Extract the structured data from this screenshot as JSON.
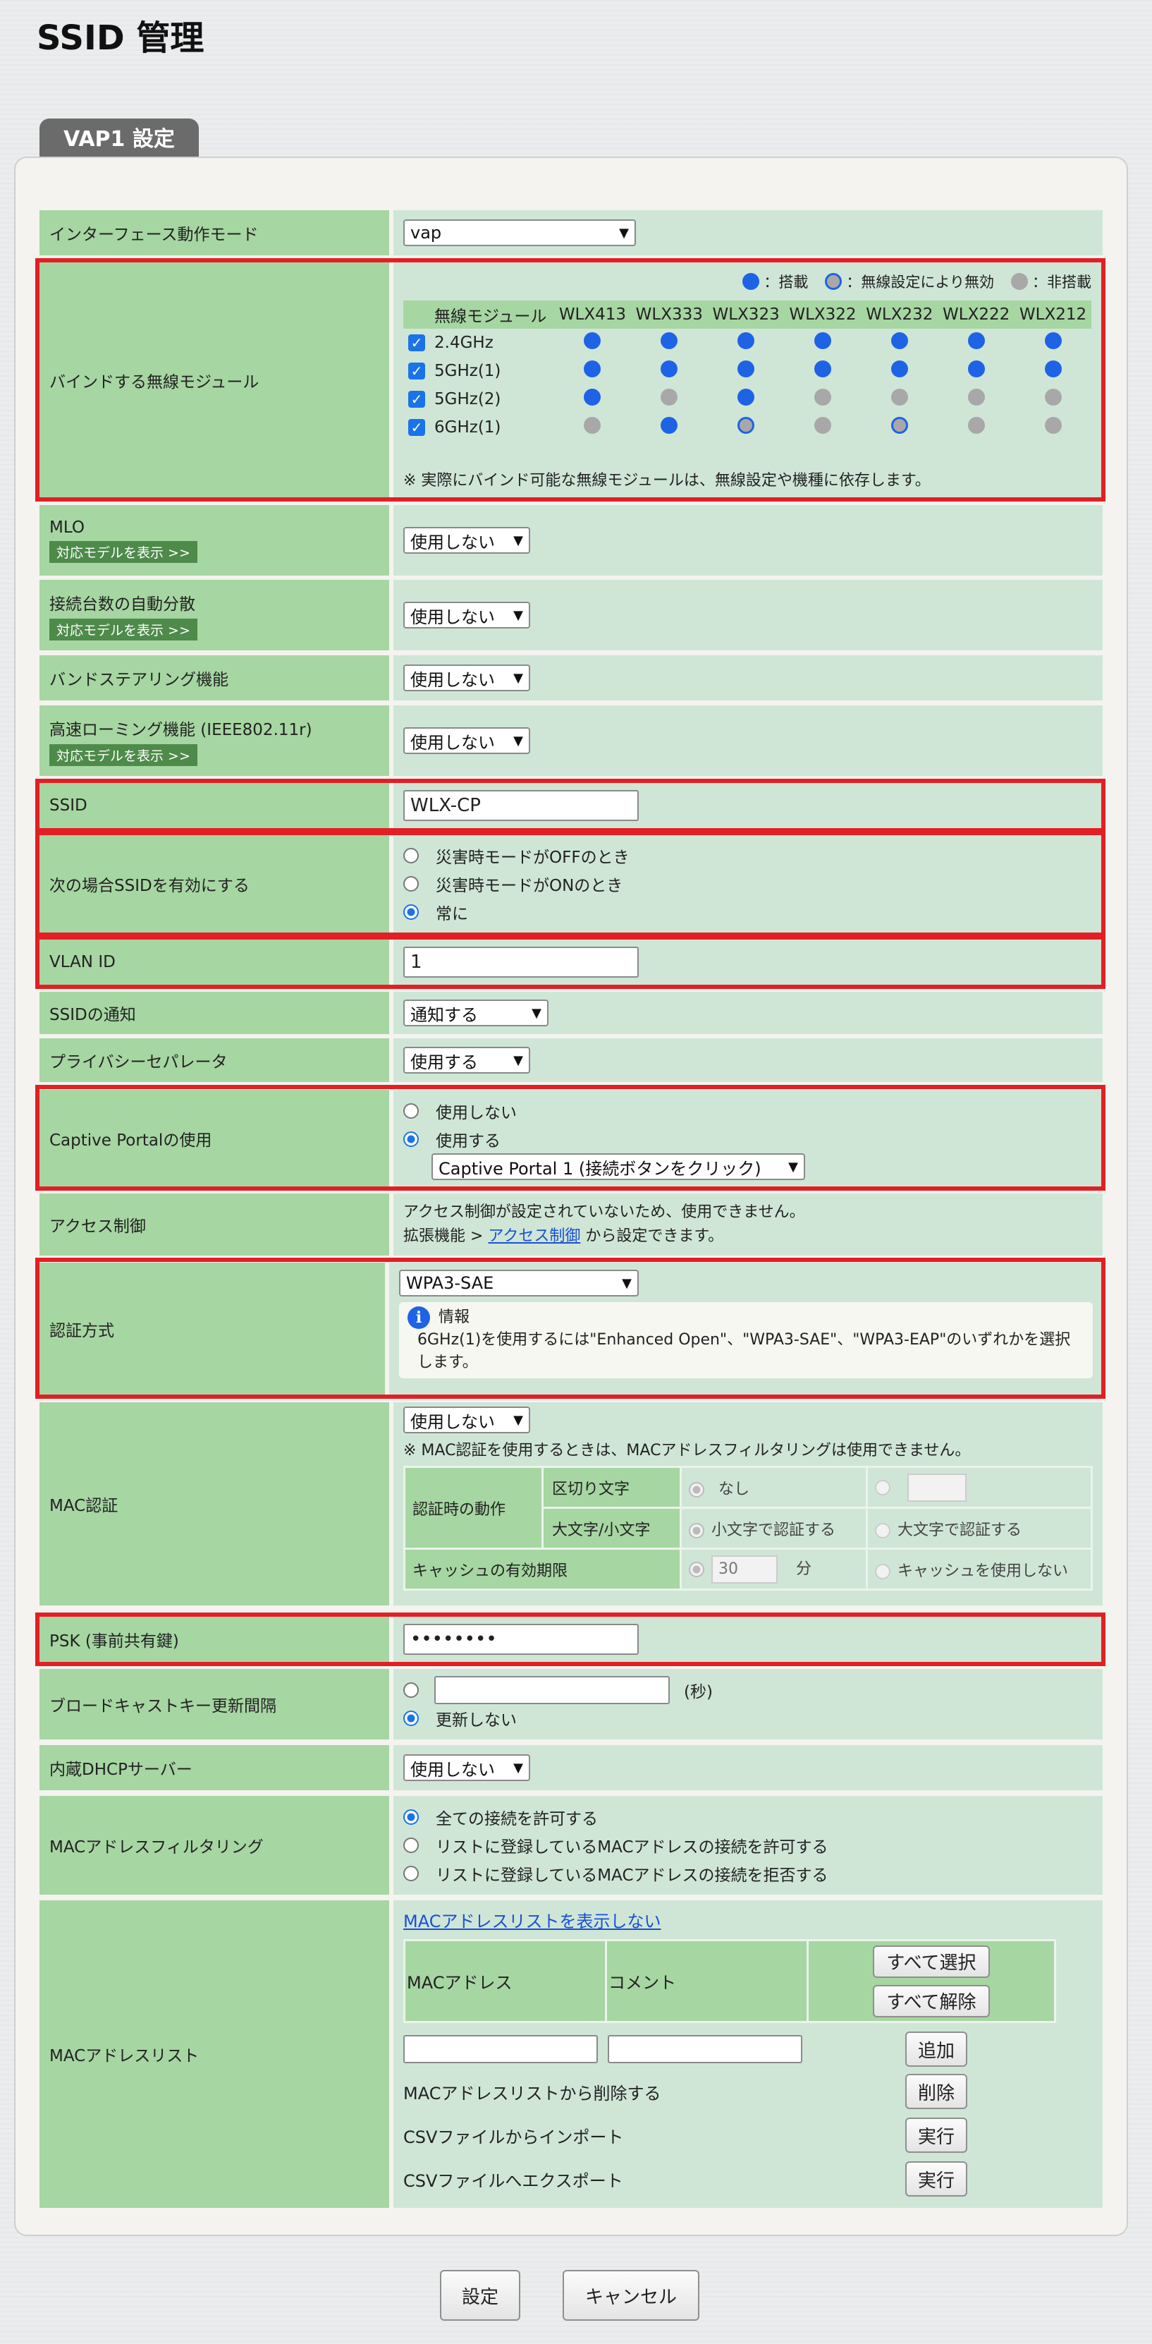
{
  "page": {
    "title": "SSID 管理"
  },
  "tab": {
    "label": "VAP1 設定"
  },
  "rows": {
    "interface_mode": {
      "label": "インターフェース動作モード",
      "value": "vap"
    },
    "bind": {
      "label": "バインドする無線モジュール",
      "legend": {
        "mounted": "：搭載",
        "disabled": "：無線設定により無効",
        "none": "：非搭載"
      },
      "module_header": "無線モジュール",
      "models": [
        "WLX413",
        "WLX333",
        "WLX323",
        "WLX322",
        "WLX232",
        "WLX222",
        "WLX212"
      ],
      "bands": [
        {
          "name": "2.4GHz",
          "checked": true,
          "states": [
            "blue",
            "blue",
            "blue",
            "blue",
            "blue",
            "blue",
            "blue"
          ]
        },
        {
          "name": "5GHz(1)",
          "checked": true,
          "states": [
            "blue",
            "blue",
            "blue",
            "blue",
            "blue",
            "blue",
            "blue"
          ]
        },
        {
          "name": "5GHz(2)",
          "checked": true,
          "states": [
            "blue",
            "gray",
            "blue",
            "gray",
            "gray",
            "gray",
            "gray"
          ]
        },
        {
          "name": "6GHz(1)",
          "checked": true,
          "states": [
            "gray",
            "blue",
            "ring",
            "gray",
            "ring",
            "gray",
            "gray"
          ]
        }
      ],
      "note": "※ 実際にバインド可能な無線モジュールは、無線設定や機種に依存します。"
    },
    "mlo": {
      "label": "MLO",
      "badge": "対応モデルを表示 >>",
      "value": "使用しない"
    },
    "load_balance": {
      "label": "接続台数の自動分散",
      "badge": "対応モデルを表示 >>",
      "value": "使用しない"
    },
    "band_steering": {
      "label": "バンドステアリング機能",
      "value": "使用しない"
    },
    "fast_roaming": {
      "label": "高速ローミング機能 (IEEE802.11r)",
      "badge": "対応モデルを表示 >>",
      "value": "使用しない"
    },
    "ssid": {
      "label": "SSID",
      "value": "WLX-CP"
    },
    "enable_when": {
      "label": "次の場合SSIDを有効にする",
      "options": [
        "災害時モードがOFFのとき",
        "災害時モードがONのとき",
        "常に"
      ],
      "selected": 2
    },
    "vlan": {
      "label": "VLAN ID",
      "value": "1"
    },
    "ssid_notify": {
      "label": "SSIDの通知",
      "value": "通知する"
    },
    "privacy": {
      "label": "プライバシーセパレータ",
      "value": "使用する"
    },
    "captive": {
      "label": "Captive Portalの使用",
      "options": [
        "使用しない",
        "使用する"
      ],
      "selected": 1,
      "portal": "Captive Portal 1 (接続ボタンをクリック)"
    },
    "access": {
      "label": "アクセス制御",
      "line1": "アクセス制御が設定されていないため、使用できません。",
      "prefix": "拡張機能 > ",
      "link": "アクセス制御",
      "suffix": " から設定できます。"
    },
    "auth": {
      "label": "認証方式",
      "value": "WPA3-SAE",
      "info_title": "情報",
      "info_text": "6GHz(1)を使用するには\"Enhanced Open\"、\"WPA3-SAE\"、\"WPA3-EAP\"のいずれかを選択します。"
    },
    "mac_auth": {
      "label": "MAC認証",
      "value": "使用しない",
      "note": "※ MAC認証を使用するときは、MACアドレスフィルタリングは使用できません。",
      "action_label": "認証時の動作",
      "delim_label": "区切り文字",
      "delim_none": "なし",
      "case_label": "大文字/小文字",
      "case_lower": "小文字で認証する",
      "case_upper": "大文字で認証する",
      "cache_label": "キャッシュの有効期限",
      "cache_value": "30",
      "cache_unit": "分",
      "cache_off": "キャッシュを使用しない"
    },
    "psk": {
      "label": "PSK (事前共有鍵)",
      "value": "••••••••"
    },
    "broadcast": {
      "label": "ブロードキャストキー更新間隔",
      "unit": "(秒)",
      "no_update": "更新しない"
    },
    "dhcp": {
      "label": "内蔵DHCPサーバー",
      "value": "使用しない"
    },
    "mac_filter": {
      "label": "MACアドレスフィルタリング",
      "options": [
        "全ての接続を許可する",
        "リストに登録しているMACアドレスの接続を許可する",
        "リストに登録しているMACアドレスの接続を拒否する"
      ],
      "selected": 0
    },
    "mac_list": {
      "label": "MACアドレスリスト",
      "hide_link": "MACアドレスリストを表示しない",
      "col_mac": "MACアドレス",
      "col_comment": "コメント",
      "select_all": "すべて選択",
      "deselect_all": "すべて解除",
      "add": "追加",
      "delete_label": "MACアドレスリストから削除する",
      "delete": "削除",
      "import_label": "CSVファイルからインポート",
      "export_label": "CSVファイルへエクスポート",
      "exec": "実行"
    }
  },
  "footer": {
    "save": "設定",
    "cancel": "キャンセル"
  }
}
